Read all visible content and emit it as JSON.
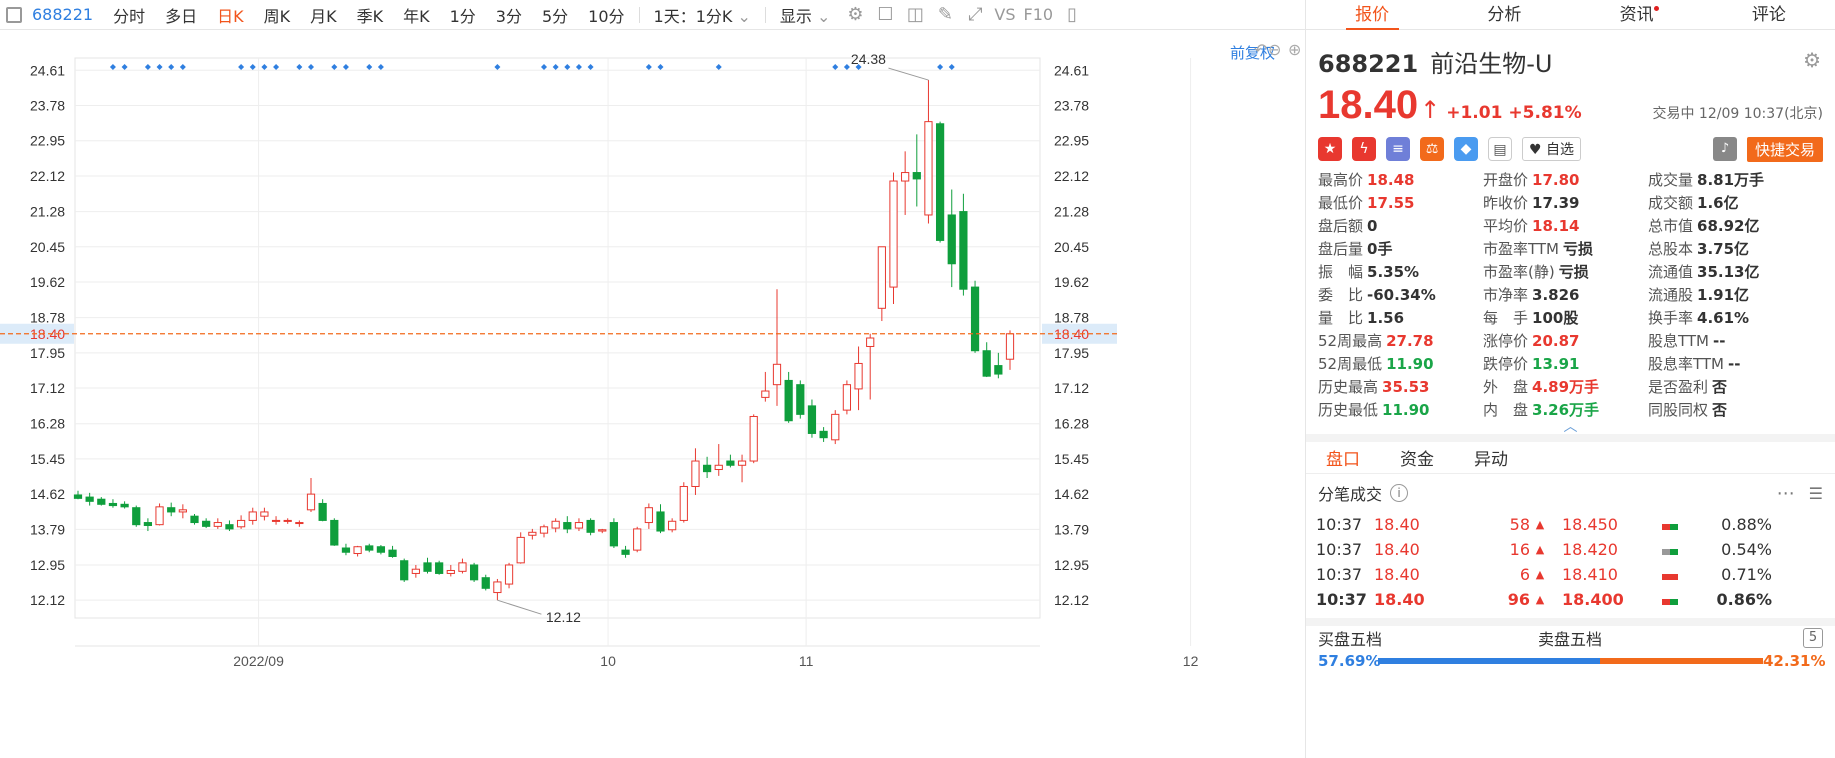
{
  "toolbar": {
    "code": "688221",
    "periods": [
      "分时",
      "多日",
      "日K",
      "周K",
      "月K",
      "季K",
      "年K",
      "1分",
      "3分",
      "5分",
      "10分"
    ],
    "active_period": "日K",
    "combo": "1天：1分K",
    "display": "显示",
    "vs": "VS",
    "f10": "F10"
  },
  "chart": {
    "fuquan": "前复权",
    "ylabels": [
      "24.61",
      "23.78",
      "22.95",
      "22.12",
      "21.28",
      "20.45",
      "19.62",
      "18.78",
      "18.40",
      "17.95",
      "17.12",
      "16.28",
      "15.45",
      "14.62",
      "13.79",
      "12.95",
      "12.12"
    ],
    "xlabels": [
      "2022/09",
      "10",
      "11",
      "12"
    ],
    "high_label": "24.38",
    "low_label": "12.12",
    "current_label": "18.40",
    "colors": {
      "up": "#e8382f",
      "down": "#0f9e3c",
      "grid": "#eeeeee",
      "dot": "#2f7fe0",
      "current": "#f26a1b"
    }
  },
  "chart_data": {
    "type": "candlestick",
    "ylim": [
      11.7,
      24.9
    ],
    "ohlc": [
      [
        14.6,
        14.7,
        14.5,
        14.52
      ],
      [
        14.55,
        14.65,
        14.35,
        14.45
      ],
      [
        14.5,
        14.55,
        14.35,
        14.38
      ],
      [
        14.4,
        14.5,
        14.3,
        14.35
      ],
      [
        14.38,
        14.45,
        14.28,
        14.32
      ],
      [
        14.3,
        14.35,
        13.85,
        13.9
      ],
      [
        13.95,
        14.05,
        13.75,
        13.88
      ],
      [
        13.9,
        14.4,
        13.88,
        14.32
      ],
      [
        14.3,
        14.42,
        14.1,
        14.2
      ],
      [
        14.2,
        14.38,
        14.05,
        14.25
      ],
      [
        14.1,
        14.15,
        13.9,
        13.95
      ],
      [
        13.98,
        14.05,
        13.82,
        13.86
      ],
      [
        13.86,
        14.05,
        13.8,
        13.95
      ],
      [
        13.9,
        14.0,
        13.75,
        13.8
      ],
      [
        13.85,
        14.12,
        13.8,
        14.0
      ],
      [
        14.0,
        14.3,
        13.9,
        14.2
      ],
      [
        14.1,
        14.3,
        14.0,
        14.2
      ],
      [
        14.0,
        14.1,
        13.9,
        14.0
      ],
      [
        14.0,
        14.05,
        13.92,
        14.0
      ],
      [
        13.95,
        14.0,
        13.85,
        13.95
      ],
      [
        14.25,
        15.0,
        14.2,
        14.62
      ],
      [
        14.4,
        14.5,
        13.98,
        14.0
      ],
      [
        14.0,
        14.05,
        13.4,
        13.42
      ],
      [
        13.35,
        13.45,
        13.18,
        13.25
      ],
      [
        13.22,
        13.4,
        13.15,
        13.38
      ],
      [
        13.4,
        13.45,
        13.25,
        13.3
      ],
      [
        13.38,
        13.42,
        13.2,
        13.25
      ],
      [
        13.3,
        13.4,
        13.12,
        13.15
      ],
      [
        13.05,
        13.1,
        12.55,
        12.6
      ],
      [
        12.75,
        12.95,
        12.65,
        12.85
      ],
      [
        13.0,
        13.12,
        12.75,
        12.8
      ],
      [
        13.0,
        13.05,
        12.72,
        12.75
      ],
      [
        12.75,
        12.95,
        12.68,
        12.82
      ],
      [
        12.8,
        13.1,
        12.75,
        13.0
      ],
      [
        12.95,
        13.0,
        12.55,
        12.6
      ],
      [
        12.65,
        12.72,
        12.35,
        12.4
      ],
      [
        12.3,
        12.62,
        12.12,
        12.55
      ],
      [
        12.5,
        13.0,
        12.4,
        12.95
      ],
      [
        13.0,
        13.72,
        12.98,
        13.6
      ],
      [
        13.65,
        13.8,
        13.55,
        13.72
      ],
      [
        13.7,
        13.9,
        13.6,
        13.85
      ],
      [
        13.82,
        14.05,
        13.72,
        13.98
      ],
      [
        13.95,
        14.1,
        13.7,
        13.8
      ],
      [
        13.82,
        14.05,
        13.75,
        13.95
      ],
      [
        14.0,
        14.05,
        13.65,
        13.72
      ],
      [
        13.75,
        13.8,
        13.7,
        13.78
      ],
      [
        13.95,
        14.05,
        13.35,
        13.4
      ],
      [
        13.3,
        13.4,
        13.12,
        13.2
      ],
      [
        13.3,
        13.85,
        13.25,
        13.8
      ],
      [
        13.95,
        14.4,
        13.8,
        14.3
      ],
      [
        14.2,
        14.38,
        13.7,
        13.75
      ],
      [
        13.78,
        14.05,
        13.72,
        13.98
      ],
      [
        14.0,
        14.9,
        13.95,
        14.8
      ],
      [
        14.8,
        15.7,
        14.6,
        15.4
      ],
      [
        15.3,
        15.5,
        15.0,
        15.15
      ],
      [
        15.2,
        15.8,
        15.05,
        15.3
      ],
      [
        15.4,
        15.55,
        15.25,
        15.3
      ],
      [
        15.3,
        15.55,
        14.9,
        15.4
      ],
      [
        15.4,
        16.5,
        15.35,
        16.45
      ],
      [
        16.9,
        17.5,
        16.8,
        17.05
      ],
      [
        17.2,
        19.45,
        16.7,
        17.68
      ],
      [
        17.3,
        17.5,
        16.3,
        16.35
      ],
      [
        17.2,
        17.3,
        16.4,
        16.5
      ],
      [
        16.7,
        16.85,
        15.95,
        16.05
      ],
      [
        16.1,
        16.2,
        15.85,
        15.95
      ],
      [
        15.9,
        16.6,
        15.8,
        16.5
      ],
      [
        16.6,
        17.3,
        16.5,
        17.2
      ],
      [
        17.1,
        18.1,
        16.6,
        17.7
      ],
      [
        18.1,
        18.4,
        16.85,
        18.3
      ],
      [
        19.0,
        20.45,
        18.7,
        20.45
      ],
      [
        19.5,
        22.2,
        19.1,
        22.0
      ],
      [
        22.0,
        22.7,
        21.2,
        22.2
      ],
      [
        22.2,
        23.1,
        21.4,
        22.05
      ],
      [
        21.2,
        24.38,
        21.0,
        23.4
      ],
      [
        23.35,
        23.4,
        20.55,
        20.6
      ],
      [
        21.2,
        21.8,
        19.5,
        20.05
      ],
      [
        21.28,
        21.7,
        19.3,
        19.45
      ],
      [
        19.5,
        19.65,
        17.95,
        18.0
      ],
      [
        18.0,
        18.2,
        17.38,
        17.4
      ],
      [
        17.65,
        17.95,
        17.35,
        17.45
      ],
      [
        17.8,
        18.48,
        17.55,
        18.4
      ]
    ],
    "signal_dots": [
      3,
      4,
      6,
      7,
      8,
      9,
      14,
      15,
      16,
      17,
      19,
      20,
      22,
      23,
      25,
      26,
      36,
      40,
      41,
      42,
      43,
      44,
      49,
      50,
      55,
      65,
      66,
      67,
      74,
      75
    ]
  },
  "quote": {
    "code": "688221",
    "name": "前沿生物-U",
    "price": "18.40",
    "arrow": "↑",
    "change": "+1.01",
    "pct": "+5.81%",
    "time": "交易中 12/09 10:37(北京)",
    "zixuan": "自选",
    "quick_trade": "快捷交易"
  },
  "tabs": {
    "quote": "报价",
    "analysis": "分析",
    "news": "资讯",
    "comment": "评论"
  },
  "stats": [
    {
      "l": "最高价",
      "v": "18.48",
      "c": "red"
    },
    {
      "l": "开盘价",
      "v": "17.80",
      "c": "red"
    },
    {
      "l": "成交量",
      "v": "8.81万手",
      "c": "blk"
    },
    {
      "l": "最低价",
      "v": "17.55",
      "c": "red"
    },
    {
      "l": "昨收价",
      "v": "17.39",
      "c": "blk"
    },
    {
      "l": "成交额",
      "v": "1.6亿",
      "c": "blk"
    },
    {
      "l": "盘后额",
      "v": "0",
      "c": "blk"
    },
    {
      "l": "平均价",
      "v": "18.14",
      "c": "red"
    },
    {
      "l": "总市值",
      "v": "68.92亿",
      "c": "blk"
    },
    {
      "l": "盘后量",
      "v": "0手",
      "c": "blk"
    },
    {
      "l": "市盈率TTM",
      "v": "亏损",
      "c": "blk"
    },
    {
      "l": "总股本",
      "v": "3.75亿",
      "c": "blk"
    },
    {
      "l": "振　幅",
      "v": "5.35%",
      "c": "blk"
    },
    {
      "l": "市盈率(静)",
      "v": "亏损",
      "c": "blk"
    },
    {
      "l": "流通值",
      "v": "35.13亿",
      "c": "blk"
    },
    {
      "l": "委　比",
      "v": "-60.34%",
      "c": "blk"
    },
    {
      "l": "市净率",
      "v": "3.826",
      "c": "blk"
    },
    {
      "l": "流通股",
      "v": "1.91亿",
      "c": "blk"
    },
    {
      "l": "量　比",
      "v": "1.56",
      "c": "blk"
    },
    {
      "l": "每　手",
      "v": "100股",
      "c": "blk"
    },
    {
      "l": "换手率",
      "v": "4.61%",
      "c": "blk"
    },
    {
      "l": "52周最高",
      "v": "27.78",
      "c": "red"
    },
    {
      "l": "涨停价",
      "v": "20.87",
      "c": "red"
    },
    {
      "l": "股息TTM",
      "v": "--",
      "c": "blk"
    },
    {
      "l": "52周最低",
      "v": "11.90",
      "c": "green"
    },
    {
      "l": "跌停价",
      "v": "13.91",
      "c": "green"
    },
    {
      "l": "股息率TTM",
      "v": "--",
      "c": "blk"
    },
    {
      "l": "历史最高",
      "v": "35.53",
      "c": "red"
    },
    {
      "l": "外　盘",
      "v": "4.89万手",
      "c": "red"
    },
    {
      "l": "是否盈利",
      "v": "否",
      "c": "blk"
    },
    {
      "l": "历史最低",
      "v": "11.90",
      "c": "green"
    },
    {
      "l": "内　盘",
      "v": "3.26万手",
      "c": "green"
    },
    {
      "l": "同股同权",
      "v": "否",
      "c": "blk"
    }
  ],
  "subtabs": [
    "盘口",
    "资金",
    "异动"
  ],
  "ticks_title": "分笔成交",
  "ticks": [
    {
      "t": "10:37",
      "p": "18.40",
      "v": "58",
      "ap": "18.450",
      "pct": "0.88%"
    },
    {
      "t": "10:37",
      "p": "18.40",
      "v": "16",
      "ap": "18.420",
      "pct": "0.54%"
    },
    {
      "t": "10:37",
      "p": "18.40",
      "v": "6",
      "ap": "18.410",
      "pct": "0.71%"
    },
    {
      "t": "10:37",
      "p": "18.40",
      "v": "96",
      "ap": "18.400",
      "pct": "0.86%"
    }
  ],
  "book": {
    "buy": "买盘五档",
    "sell": "卖盘五档",
    "badge": "5",
    "buy_pct": "57.69%",
    "sell_pct": "42.31%"
  }
}
